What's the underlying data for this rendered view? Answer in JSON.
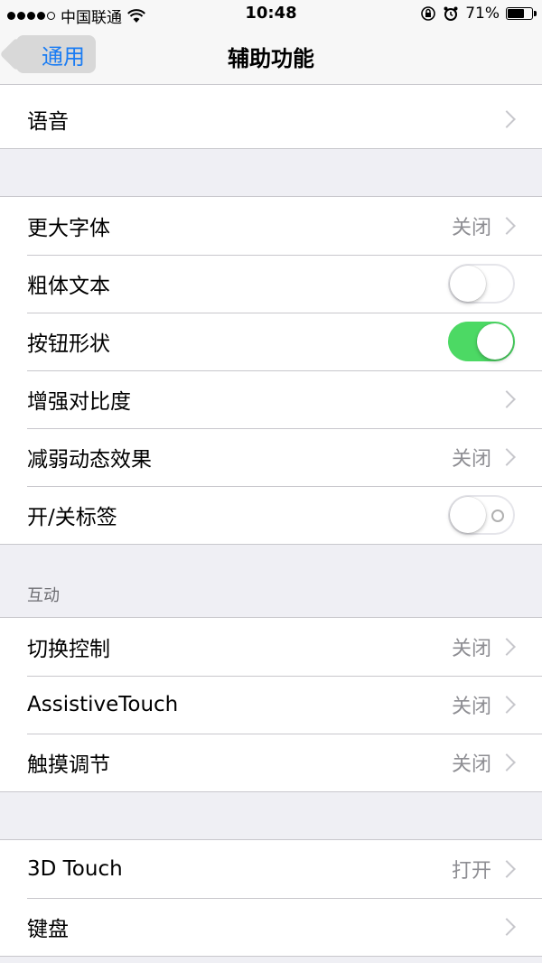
{
  "status": {
    "carrier": "中国联通",
    "time": "10:48",
    "battery_pct": "71%",
    "battery_fill": 0.71
  },
  "nav": {
    "back_label": "通用",
    "title": "辅助功能"
  },
  "group1": {
    "items": [
      {
        "label": "语音"
      }
    ]
  },
  "group2": {
    "items": [
      {
        "label": "更大字体",
        "value": "关闭"
      },
      {
        "label": "粗体文本",
        "toggle": false
      },
      {
        "label": "按钮形状",
        "toggle": true
      },
      {
        "label": "增强对比度"
      },
      {
        "label": "减弱动态效果",
        "value": "关闭"
      },
      {
        "label": "开/关标签",
        "toggle": false
      }
    ]
  },
  "group3": {
    "header": "互动",
    "items": [
      {
        "label": "切换控制",
        "value": "关闭"
      },
      {
        "label": "AssistiveTouch",
        "value": "关闭"
      },
      {
        "label": "触摸调节",
        "value": "关闭"
      }
    ]
  },
  "group4": {
    "items": [
      {
        "label": "3D Touch",
        "value": "打开"
      },
      {
        "label": "键盘"
      }
    ]
  },
  "colors": {
    "accent": "#1a7cf3",
    "toggle_on": "#4cd964",
    "background": "#efeff4"
  }
}
